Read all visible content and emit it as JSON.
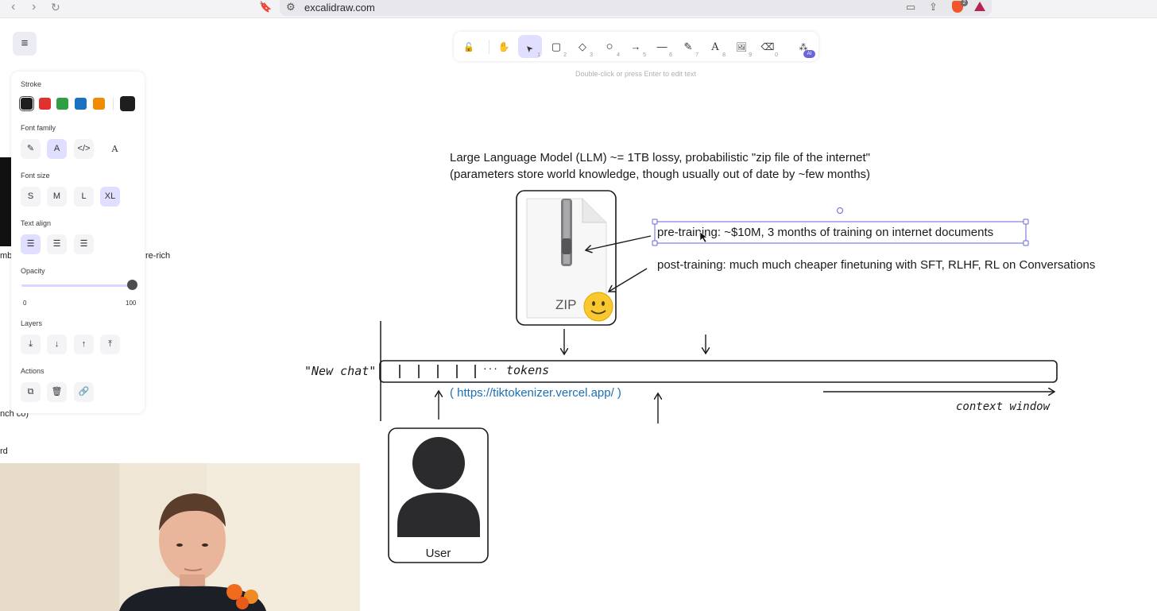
{
  "browser": {
    "url": "excalidraw.com",
    "brave_badge_count": "2"
  },
  "toolbar": {
    "tools": [
      {
        "name": "lock",
        "glyph": "🔓",
        "key": ""
      },
      {
        "name": "hand",
        "glyph": "✋",
        "key": ""
      },
      {
        "name": "selection",
        "glyph": "➤",
        "key": "1"
      },
      {
        "name": "rectangle",
        "glyph": "▢",
        "key": "2"
      },
      {
        "name": "diamond",
        "glyph": "◇",
        "key": "3"
      },
      {
        "name": "ellipse",
        "glyph": "○",
        "key": "4"
      },
      {
        "name": "arrow",
        "glyph": "→",
        "key": "5"
      },
      {
        "name": "line",
        "glyph": "—",
        "key": "6"
      },
      {
        "name": "draw",
        "glyph": "✎",
        "key": "7"
      },
      {
        "name": "text",
        "glyph": "A",
        "key": "8"
      },
      {
        "name": "image",
        "glyph": "🖼",
        "key": "9"
      },
      {
        "name": "eraser",
        "glyph": "⌫",
        "key": "0"
      },
      {
        "name": "more-tools",
        "glyph": "⁂",
        "key": ""
      }
    ],
    "ai_badge": "AI",
    "hint": "Double-click or press Enter to edit text"
  },
  "panel": {
    "stroke_label": "Stroke",
    "stroke_colors": [
      "#1e1e1e",
      "#e03131",
      "#2f9e44",
      "#1971c2",
      "#f08c00"
    ],
    "current_stroke": "#1e1e1e",
    "font_family_label": "Font family",
    "font_size_label": "Font size",
    "font_sizes": [
      "S",
      "M",
      "L",
      "XL"
    ],
    "text_align_label": "Text align",
    "opacity_label": "Opacity",
    "opacity_min": "0",
    "opacity_max": "100",
    "opacity_value": 100,
    "layers_label": "Layers",
    "actions_label": "Actions"
  },
  "left_fragments": {
    "frag1": "mb",
    "frag2": "re-rich",
    "frag3": "nch co)",
    "frag4": "rd"
  },
  "drawing": {
    "llm_line1": "Large Language Model (LLM) ~= 1TB lossy, probabilistic \"zip file of the internet\"",
    "llm_line2": "(parameters store world knowledge, though usually out of date by ~few months)",
    "zip_label": "ZIP",
    "pretraining": "pre-training: ~$10M, 3 months of training on internet documents",
    "posttraining": "post-training: much much cheaper finetuning with SFT, RLHF, RL on Conversations",
    "new_chat": "\"New chat\"",
    "ellipsis": "···",
    "tokens": "tokens",
    "tokenizer_link": "( https://tiktokenizer.vercel.app/ )",
    "context_window": "context window",
    "user_label": "User"
  }
}
